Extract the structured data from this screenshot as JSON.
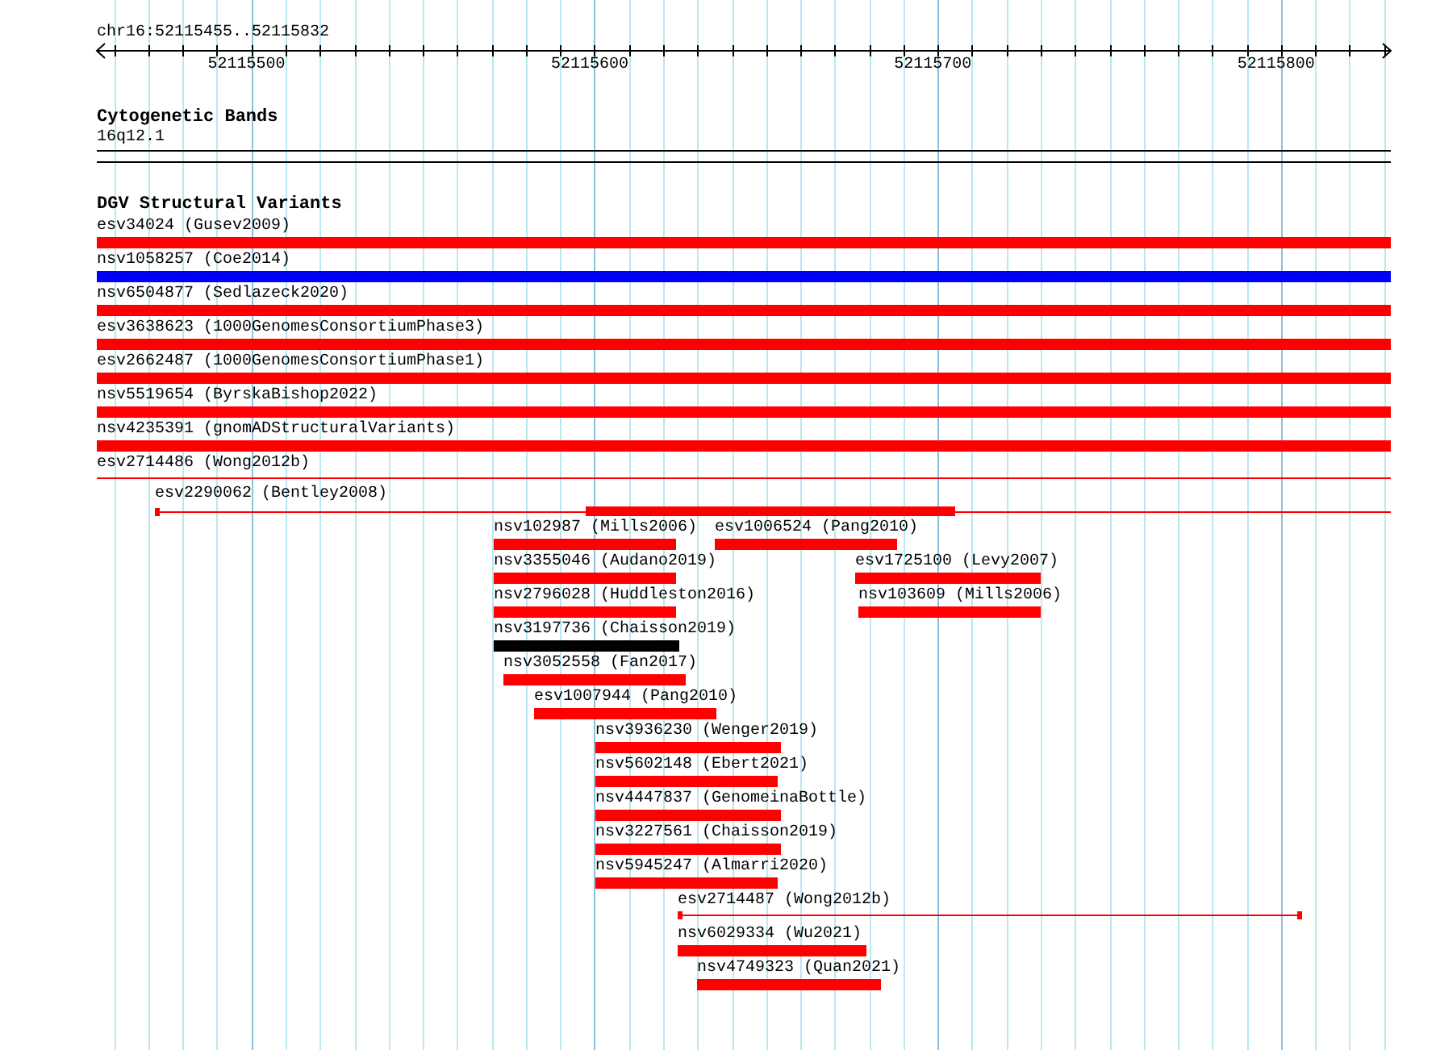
{
  "locus": "chr16:52115455..52115832",
  "ruler": {
    "ticks": [
      "52115500",
      "52115600",
      "52115700",
      "52115800"
    ]
  },
  "tracks": [
    {
      "title": "Cytogenetic Bands",
      "features": [
        {
          "label": "16q12.1",
          "kind": "band"
        }
      ]
    },
    {
      "title": "DGV Structural Variants",
      "features": [
        {
          "label": "esv34024 (Gusev2009)",
          "kind": "bar",
          "color": "#ff0000"
        },
        {
          "label": "nsv1058257 (Coe2014)",
          "kind": "bar",
          "color": "#0000ff"
        },
        {
          "label": "nsv6504877 (Sedlazeck2020)",
          "kind": "bar",
          "color": "#ff0000"
        },
        {
          "label": "esv3638623 (1000GenomesConsortiumPhase3)",
          "kind": "bar",
          "color": "#ff0000"
        },
        {
          "label": "esv2662487 (1000GenomesConsortiumPhase1)",
          "kind": "bar",
          "color": "#ff0000"
        },
        {
          "label": "nsv5519654 (ByrskaBishop2022)",
          "kind": "bar",
          "color": "#ff0000"
        },
        {
          "label": "nsv4235391 (gnomADStructuralVariants)",
          "kind": "bar",
          "color": "#ff0000"
        },
        {
          "label": "esv2714486 (Wong2012b)",
          "kind": "line",
          "color": "#ff0000"
        },
        {
          "label": "esv2290062 (Bentley2008)",
          "kind": "bar-and-line",
          "color": "#ff0000"
        },
        {
          "label": "nsv102987 (Mills2006)",
          "kind": "bar",
          "color": "#ff0000"
        },
        {
          "label": "esv1006524 (Pang2010)",
          "kind": "bar",
          "color": "#ff0000"
        },
        {
          "label": "nsv3355046 (Audano2019)",
          "kind": "bar",
          "color": "#ff0000"
        },
        {
          "label": "esv1725100 (Levy2007)",
          "kind": "bar",
          "color": "#ff0000"
        },
        {
          "label": "nsv2796028 (Huddleston2016)",
          "kind": "bar",
          "color": "#ff0000"
        },
        {
          "label": "nsv103609 (Mills2006)",
          "kind": "bar",
          "color": "#ff0000"
        },
        {
          "label": "nsv3197736 (Chaisson2019)",
          "kind": "bar",
          "color": "#000000"
        },
        {
          "label": "nsv3052558 (Fan2017)",
          "kind": "bar",
          "color": "#ff0000"
        },
        {
          "label": "esv1007944 (Pang2010)",
          "kind": "bar",
          "color": "#ff0000"
        },
        {
          "label": "nsv3936230 (Wenger2019)",
          "kind": "bar",
          "color": "#ff0000"
        },
        {
          "label": "nsv5602148 (Ebert2021)",
          "kind": "bar",
          "color": "#ff0000"
        },
        {
          "label": "nsv4447837 (GenomeinaBottle)",
          "kind": "bar",
          "color": "#ff0000"
        },
        {
          "label": "nsv3227561 (Chaisson2019)",
          "kind": "bar",
          "color": "#ff0000"
        },
        {
          "label": "nsv5945247 (Almarri2020)",
          "kind": "bar",
          "color": "#ff0000"
        },
        {
          "label": "esv2714487 (Wong2012b)",
          "kind": "line",
          "color": "#ff0000"
        },
        {
          "label": "nsv6029334 (Wu2021)",
          "kind": "bar",
          "color": "#ff0000"
        },
        {
          "label": "nsv4749323 (Quan2021)",
          "kind": "bar",
          "color": "#ff0000"
        }
      ]
    }
  ]
}
